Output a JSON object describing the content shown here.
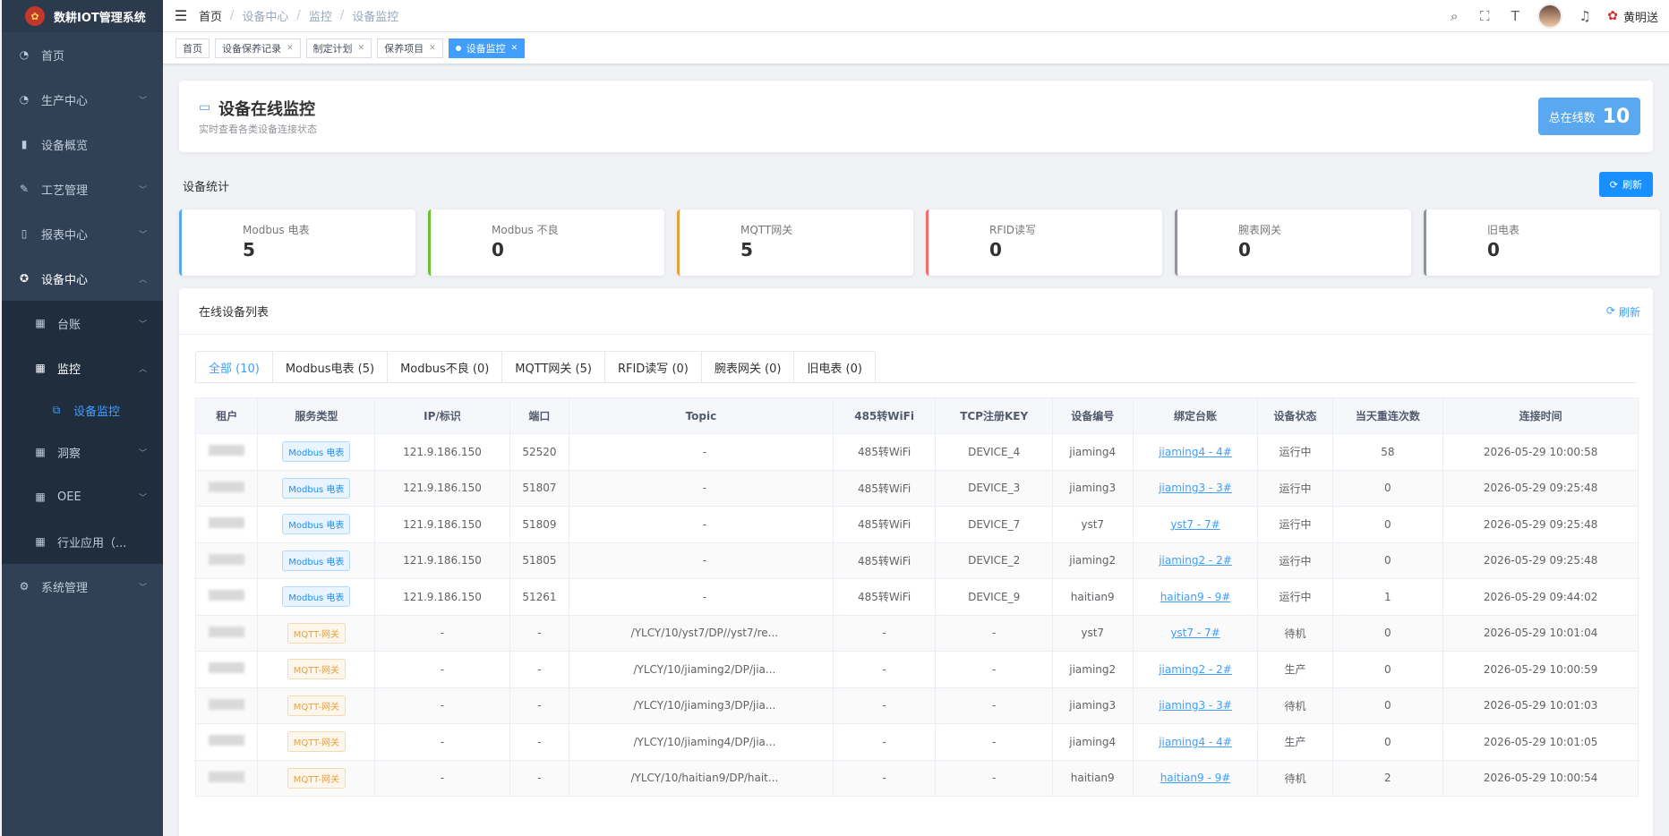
{
  "app": {
    "title": "数耕IOT管理系统"
  },
  "sidebar": {
    "items": [
      {
        "label": "首页",
        "icon": "dashboard-icon"
      },
      {
        "label": "生产中心",
        "icon": "dashboard-icon"
      },
      {
        "label": "设备概览",
        "icon": "bar-chart-icon"
      },
      {
        "label": "工艺管理",
        "icon": "edit-icon"
      },
      {
        "label": "报表中心",
        "icon": "book-icon"
      },
      {
        "label": "设备中心",
        "icon": "settings-icon"
      },
      {
        "label": "台账",
        "icon": "grid-icon"
      },
      {
        "label": "监控",
        "icon": "grid-icon"
      },
      {
        "label": "设备监控",
        "icon": "external-link-icon"
      },
      {
        "label": "洞察",
        "icon": "grid-icon"
      },
      {
        "label": "OEE",
        "icon": "grid-icon"
      },
      {
        "label": "行业应用（...",
        "icon": "grid-icon"
      },
      {
        "label": "系统管理",
        "icon": "gear-icon"
      }
    ]
  },
  "header": {
    "breadcrumb": [
      "首页",
      "设备中心",
      "监控",
      "设备监控"
    ],
    "user": "黄明送"
  },
  "tags": [
    "首页",
    "设备保养记录",
    "制定计划",
    "保养项目",
    "设备监控"
  ],
  "page": {
    "title": "设备在线监控",
    "subtitle": "实时查看各类设备连接状态",
    "online_label": "总在线数",
    "online_value": "10",
    "stats_label": "设备统计",
    "refresh": "刷新"
  },
  "stats": [
    {
      "label": "Modbus 电表",
      "value": "5",
      "color": "#5aa9f0"
    },
    {
      "label": "Modbus 不良",
      "value": "0",
      "color": "#67c23a"
    },
    {
      "label": "MQTT网关",
      "value": "5",
      "color": "#e6a23c"
    },
    {
      "label": "RFID读写",
      "value": "0",
      "color": "#f56c6c"
    },
    {
      "label": "腕表网关",
      "value": "0",
      "color": "#909399"
    },
    {
      "label": "旧电表",
      "value": "0",
      "color": "#909399"
    }
  ],
  "list": {
    "title": "在线设备列表",
    "refresh": "刷新",
    "tabs": [
      "全部 (10)",
      "Modbus电表 (5)",
      "Modbus不良 (0)",
      "MQTT网关 (5)",
      "RFID读写 (0)",
      "腕表网关 (0)",
      "旧电表 (0)"
    ],
    "columns": [
      "租户",
      "服务类型",
      "IP/标识",
      "端口",
      "Topic",
      "485转WiFi",
      "TCP注册KEY",
      "设备编号",
      "绑定台账",
      "设备状态",
      "当天重连次数",
      "连接时间"
    ],
    "rows": [
      {
        "svc": "Modbus 电表",
        "type": "modbus",
        "ip": "121.9.186.150",
        "port": "52520",
        "topic": "-",
        "wifi": "485转WiFi",
        "key": "DEVICE_4",
        "code": "jiaming4",
        "ledger": "jiaming4 - 4#",
        "status": "运行中",
        "reconnect": "58",
        "time": "2026-05-29 10:00:58"
      },
      {
        "svc": "Modbus 电表",
        "type": "modbus",
        "ip": "121.9.186.150",
        "port": "51807",
        "topic": "-",
        "wifi": "485转WiFi",
        "key": "DEVICE_3",
        "code": "jiaming3",
        "ledger": "jiaming3 - 3#",
        "status": "运行中",
        "reconnect": "0",
        "time": "2026-05-29 09:25:48"
      },
      {
        "svc": "Modbus 电表",
        "type": "modbus",
        "ip": "121.9.186.150",
        "port": "51809",
        "topic": "-",
        "wifi": "485转WiFi",
        "key": "DEVICE_7",
        "code": "yst7",
        "ledger": "yst7 - 7#",
        "status": "运行中",
        "reconnect": "0",
        "time": "2026-05-29 09:25:48"
      },
      {
        "svc": "Modbus 电表",
        "type": "modbus",
        "ip": "121.9.186.150",
        "port": "51805",
        "topic": "-",
        "wifi": "485转WiFi",
        "key": "DEVICE_2",
        "code": "jiaming2",
        "ledger": "jiaming2 - 2#",
        "status": "运行中",
        "reconnect": "0",
        "time": "2026-05-29 09:25:48"
      },
      {
        "svc": "Modbus 电表",
        "type": "modbus",
        "ip": "121.9.186.150",
        "port": "51261",
        "topic": "-",
        "wifi": "485转WiFi",
        "key": "DEVICE_9",
        "code": "haitian9",
        "ledger": "haitian9 - 9#",
        "status": "运行中",
        "reconnect": "1",
        "time": "2026-05-29 09:44:02"
      },
      {
        "svc": "MQTT-网关",
        "type": "mqtt",
        "ip": "-",
        "port": "-",
        "topic": "/YLCY/10/yst7/DP//yst7/re...",
        "wifi": "-",
        "key": "-",
        "code": "yst7",
        "ledger": "yst7 - 7#",
        "status": "待机",
        "reconnect": "0",
        "time": "2026-05-29 10:01:04"
      },
      {
        "svc": "MQTT-网关",
        "type": "mqtt",
        "ip": "-",
        "port": "-",
        "topic": "/YLCY/10/jiaming2/DP/jia...",
        "wifi": "-",
        "key": "-",
        "code": "jiaming2",
        "ledger": "jiaming2 - 2#",
        "status": "生产",
        "reconnect": "0",
        "time": "2026-05-29 10:00:59"
      },
      {
        "svc": "MQTT-网关",
        "type": "mqtt",
        "ip": "-",
        "port": "-",
        "topic": "/YLCY/10/jiaming3/DP/jia...",
        "wifi": "-",
        "key": "-",
        "code": "jiaming3",
        "ledger": "jiaming3 - 3#",
        "status": "待机",
        "reconnect": "0",
        "time": "2026-05-29 10:01:03"
      },
      {
        "svc": "MQTT-网关",
        "type": "mqtt",
        "ip": "-",
        "port": "-",
        "topic": "/YLCY/10/jiaming4/DP/jia...",
        "wifi": "-",
        "key": "-",
        "code": "jiaming4",
        "ledger": "jiaming4 - 4#",
        "status": "生产",
        "reconnect": "0",
        "time": "2026-05-29 10:01:05"
      },
      {
        "svc": "MQTT-网关",
        "type": "mqtt",
        "ip": "-",
        "port": "-",
        "topic": "/YLCY/10/haitian9/DP/hait...",
        "wifi": "-",
        "key": "-",
        "code": "haitian9",
        "ledger": "haitian9 - 9#",
        "status": "待机",
        "reconnect": "2",
        "time": "2026-05-29 10:00:54"
      }
    ]
  }
}
